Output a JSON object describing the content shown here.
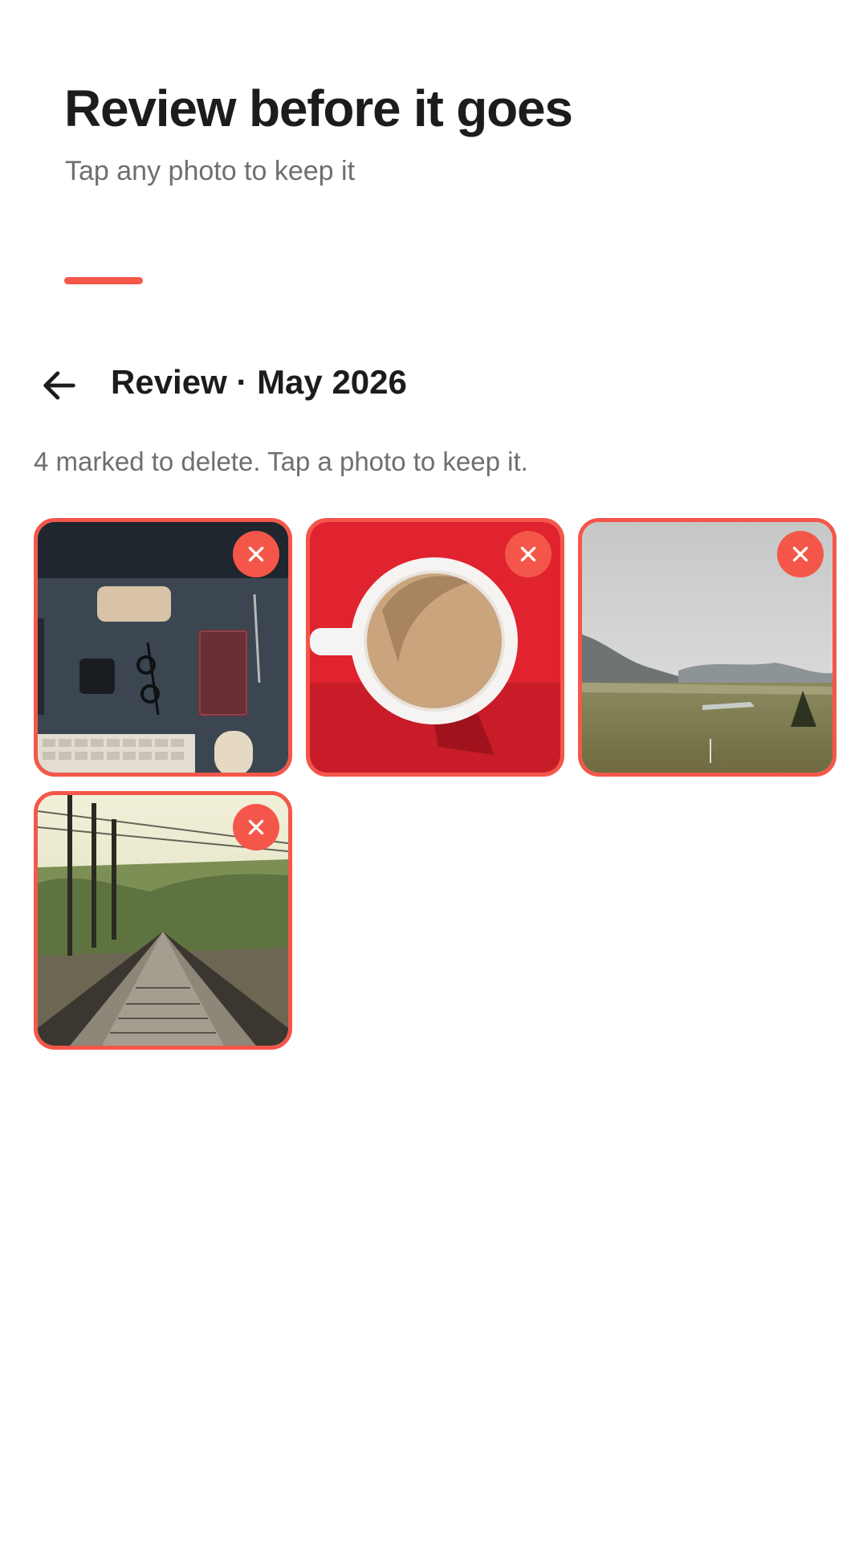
{
  "header": {
    "title": "Review before it goes",
    "subtitle": "Tap any photo to keep it"
  },
  "nav": {
    "back_icon": "arrow-left-icon",
    "title": "Review · May 2026"
  },
  "status": {
    "marked_count": 4,
    "text": "4 marked to delete. Tap a photo to keep it."
  },
  "photos": [
    {
      "subject": "desk-flatlay",
      "marked_for_deletion": true
    },
    {
      "subject": "coffee-cup",
      "marked_for_deletion": true
    },
    {
      "subject": "mountain-field",
      "marked_for_deletion": true
    },
    {
      "subject": "railway-tracks",
      "marked_for_deletion": true
    }
  ],
  "colors": {
    "accent": "#f4574a",
    "title_text": "#1c1c1e",
    "secondary_text": "#6e6e73",
    "background": "#ffffff"
  }
}
